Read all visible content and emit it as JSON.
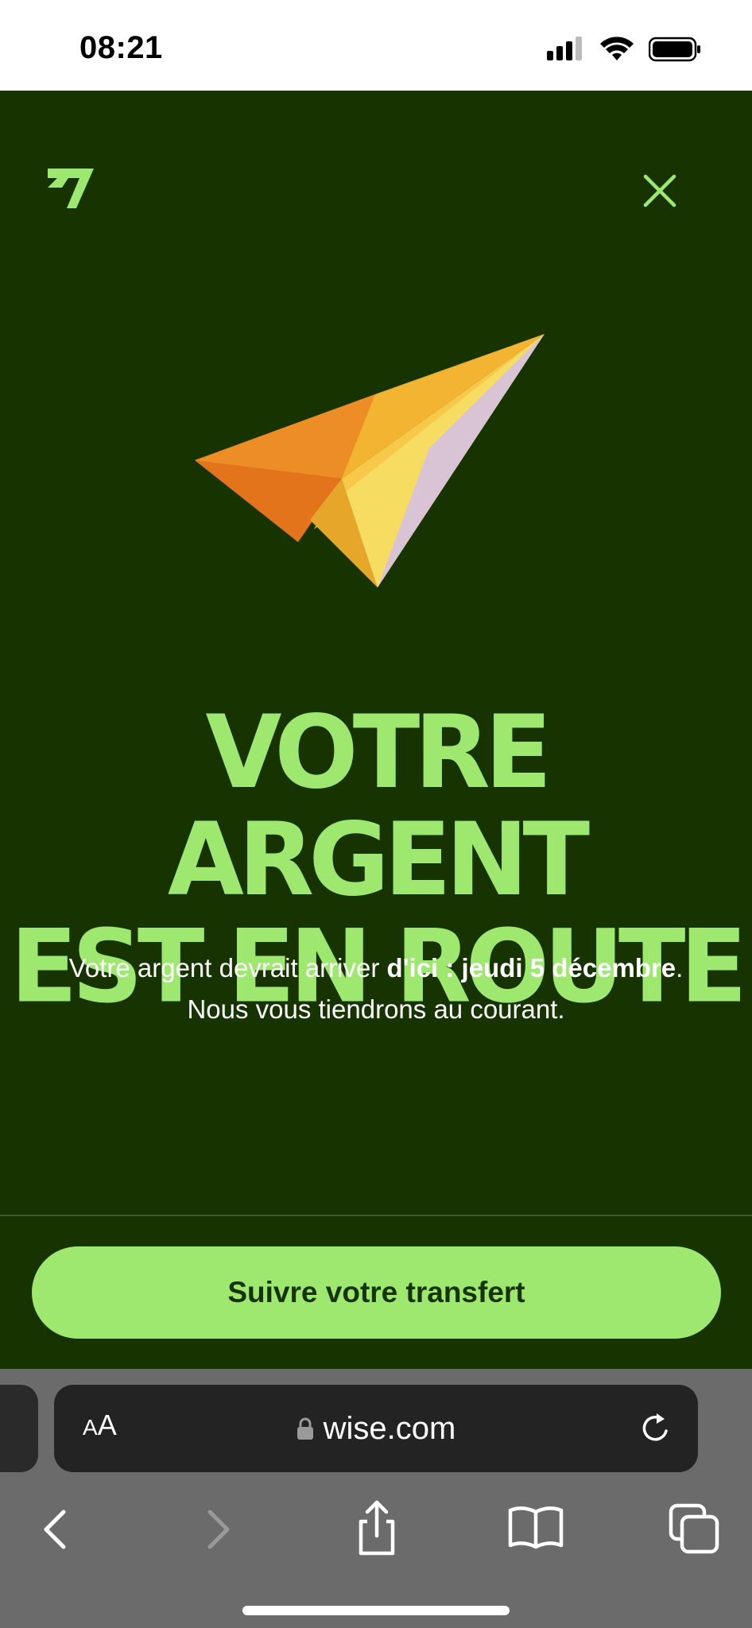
{
  "status_bar": {
    "time": "08:21"
  },
  "app": {
    "headline_line1": "VOTRE ARGENT",
    "headline_line2": "EST EN ROUTE",
    "subtext_prefix": "Votre argent devrait arriver ",
    "subtext_bold": "d'ici : jeudi 5 décembre",
    "subtext_suffix": ".",
    "subtext_line2": "Nous vous tiendrons au courant.",
    "cta_label": "Suivre votre transfert"
  },
  "browser": {
    "aa_label_small": "A",
    "aa_label_large": "A",
    "url": "wise.com"
  },
  "colors": {
    "background": "#163300",
    "accent": "#9fe870"
  },
  "icons": [
    "wise-logo-icon",
    "close-icon",
    "paper-plane-illustration",
    "lock-icon",
    "reload-icon",
    "back-icon",
    "forward-icon",
    "share-icon",
    "bookmarks-icon",
    "tabs-icon"
  ]
}
